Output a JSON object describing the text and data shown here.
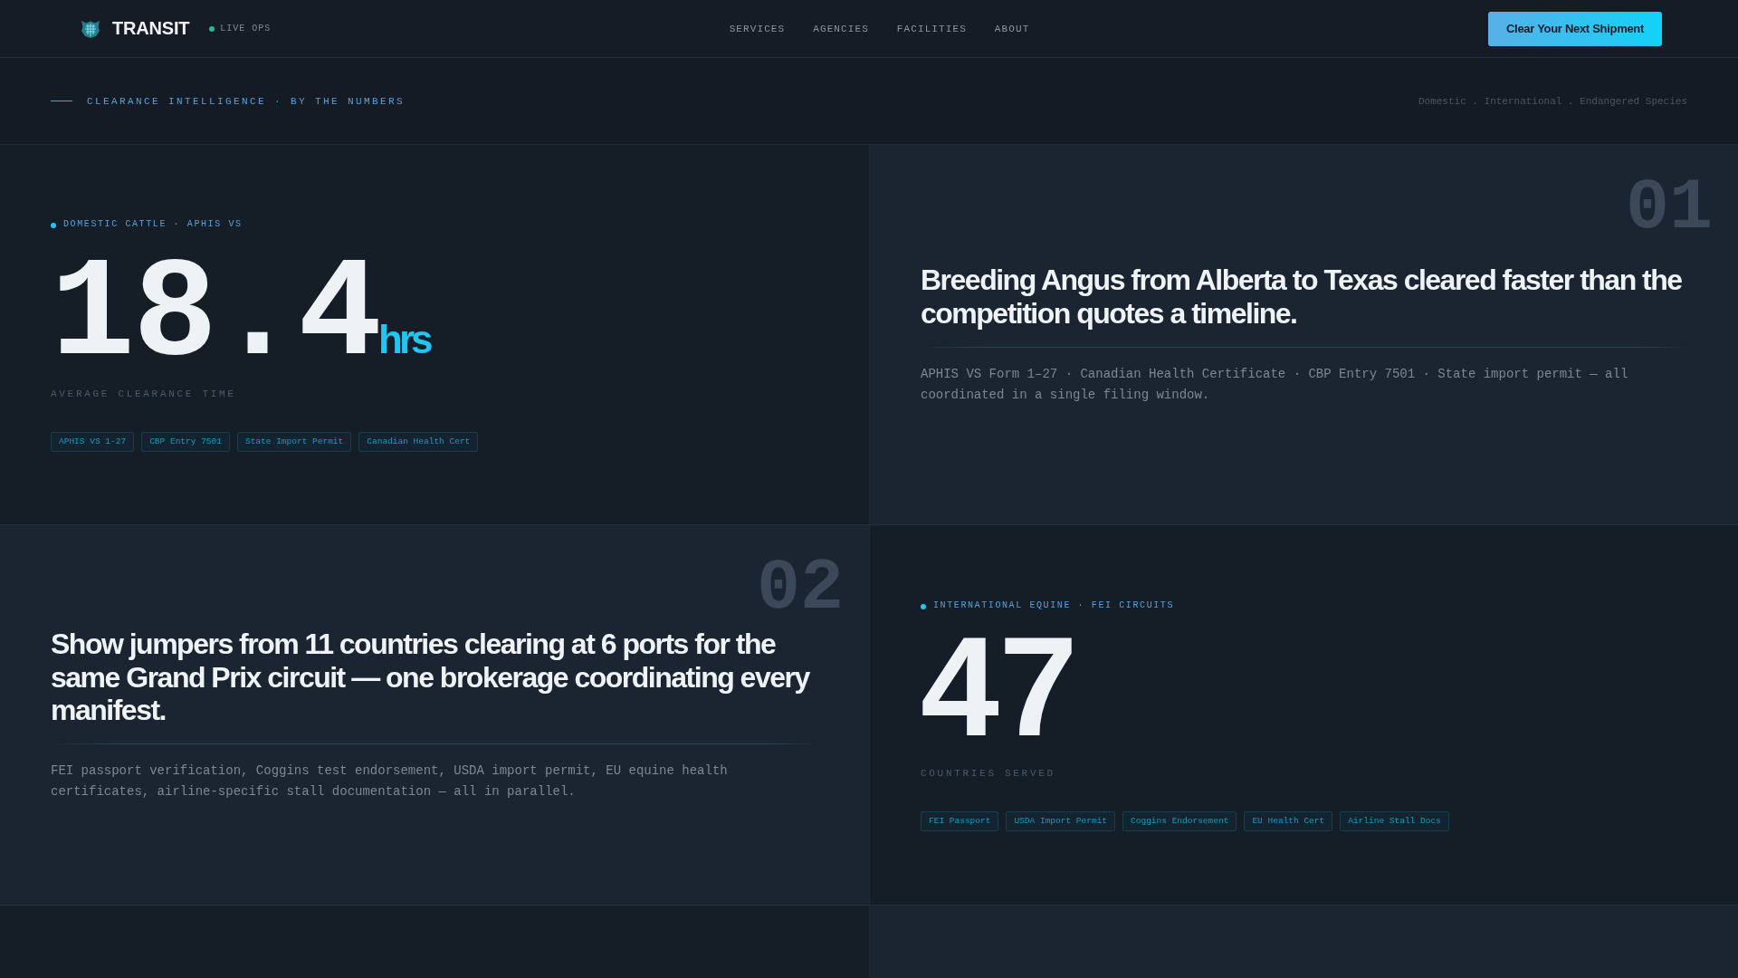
{
  "nav": {
    "brand": "TRANSIT",
    "status": "LIVE OPS",
    "links": [
      "SERVICES",
      "AGENCIES",
      "FACILITIES",
      "ABOUT"
    ],
    "cta": "Clear Your Next Shipment"
  },
  "section_header": {
    "eyebrow": "CLEARANCE INTELLIGENCE · BY THE NUMBERS",
    "filters": [
      "Domestic",
      "International",
      "Endangered Species"
    ],
    "filter_separator": "."
  },
  "panels": [
    {
      "kind": "stat",
      "tag": "DOMESTIC CATTLE · APHIS VS",
      "value": "18.4",
      "unit": "hrs",
      "label": "AVERAGE CLEARANCE TIME",
      "documents": [
        "APHIS VS 1-27",
        "CBP Entry 7501",
        "State Import Permit",
        "Canadian Health Cert"
      ]
    },
    {
      "kind": "story",
      "number": "01",
      "headline": "Breeding Angus from Alberta to Texas cleared faster than the competition quotes a timeline.",
      "details": "APHIS VS Form 1–27 · Canadian Health Certificate · CBP Entry 7501 · State import permit — all coordinated in a single filing window."
    },
    {
      "kind": "story",
      "number": "02",
      "headline": "Show jumpers from 11 countries clearing at 6 ports for the same Grand Prix circuit — one brokerage coordinating every manifest.",
      "details": "FEI passport verification, Coggins test endorsement, USDA import permit, EU equine health certificates, airline-specific stall documentation — all in parallel."
    },
    {
      "kind": "stat",
      "tag": "INTERNATIONAL EQUINE · FEI CIRCUITS",
      "value": "47",
      "label": "COUNTRIES SERVED",
      "documents": [
        "FEI Passport",
        "USDA Import Permit",
        "Coggins Endorsement",
        "EU Health Cert",
        "Airline Stall Docs"
      ]
    },
    {
      "kind": "stat"
    },
    {
      "kind": "story"
    }
  ]
}
